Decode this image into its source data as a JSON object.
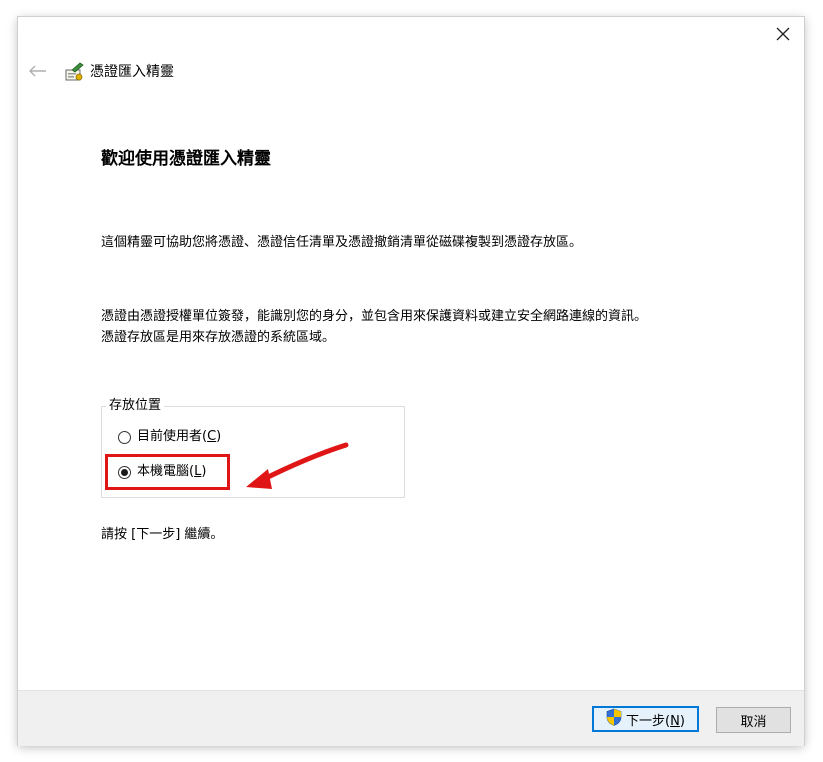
{
  "window": {
    "title": "憑證匯入精靈",
    "close_glyph": "✕",
    "back_glyph": "←"
  },
  "content": {
    "heading": "歡迎使用憑證匯入精靈",
    "paragraph1": "這個精靈可協助您將憑證、憑證信任清單及憑證撤銷清單從磁碟複製到憑證存放區。",
    "paragraph2_line1": "憑證由憑證授權單位簽發，能識別您的身分，並包含用來保護資料或建立安全網路連線的資訊。",
    "paragraph2_line2": "憑證存放區是用來存放憑證的系統區域。",
    "store_location": {
      "legend": "存放位置",
      "options": [
        {
          "label_main": "目前使用者(",
          "accel": "C",
          "label_end": ")",
          "checked": false
        },
        {
          "label_main": "本機電腦(",
          "accel": "L",
          "label_end": ")",
          "checked": true
        }
      ]
    },
    "continue_text": "請按 [下一步] 繼續。"
  },
  "footer": {
    "next_main": "下一步(",
    "next_accel": "N",
    "next_end": ")",
    "cancel_label": "取消"
  },
  "colors": {
    "highlight": "#e01616",
    "focus_border": "#0078d7",
    "footer_bg": "#f0f0f0"
  }
}
